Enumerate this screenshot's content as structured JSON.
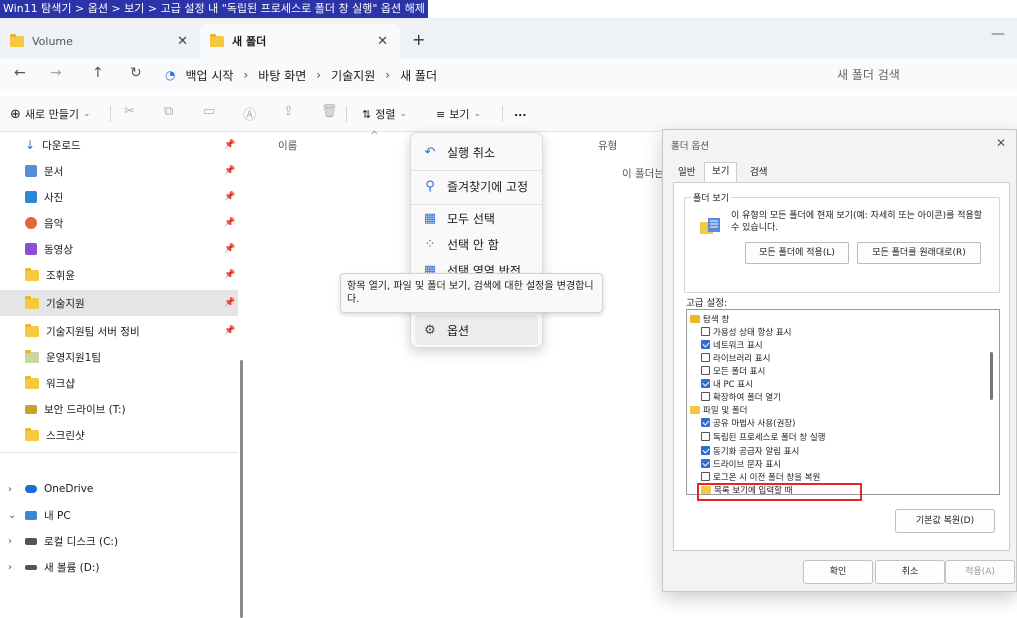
{
  "caption": "Win11 탐색기 > 옵션 > 보기 > 고급 설정 내 \"독립된 프로세스로 폴더 창 실행\" 옵션 해제",
  "tabs": [
    {
      "label": "Volume"
    },
    {
      "label": "새 폴더"
    }
  ],
  "address": {
    "crumbs": [
      "백업 시작",
      "바탕 화면",
      "기술지원",
      "새 폴더"
    ],
    "search_placeholder": "새 폴더 검색"
  },
  "toolbar": {
    "new_label": "새로 만들기",
    "sort_label": "정렬",
    "view_label": "보기",
    "more_label": "..."
  },
  "sidebar": {
    "items": [
      {
        "label": "다운로드",
        "icon": "download-icon",
        "color": "#2f6fd1"
      },
      {
        "label": "문서",
        "icon": "document-icon",
        "color": "#5b8bd8"
      },
      {
        "label": "사진",
        "icon": "pictures-icon",
        "color": "#2b88d8"
      },
      {
        "label": "음악",
        "icon": "music-icon",
        "color": "#e8633a"
      },
      {
        "label": "동영상",
        "icon": "video-icon",
        "color": "#8a4fd6"
      },
      {
        "label": "조휘윤",
        "icon": "folder-icon",
        "color": "#f5c842"
      },
      {
        "label": "기술지원",
        "icon": "folder-icon",
        "color": "#f5c842"
      },
      {
        "label": "기술지원팀 서버 정비",
        "icon": "folder-icon",
        "color": "#f5c842"
      },
      {
        "label": "운영지원1팀",
        "icon": "shared-folder-icon",
        "color": "#6aa84f"
      },
      {
        "label": "워크샵",
        "icon": "folder-icon",
        "color": "#f5c842"
      },
      {
        "label": "보안 드라이브 (T:)",
        "icon": "drive-icon",
        "color": "#c9a227"
      },
      {
        "label": "스크린샷",
        "icon": "folder-icon",
        "color": "#f5c842"
      }
    ],
    "tree": [
      {
        "label": "OneDrive",
        "icon": "cloud-icon"
      },
      {
        "label": "내 PC",
        "icon": "pc-icon"
      },
      {
        "label": "로컬 디스크 (C:)",
        "icon": "drive-icon"
      },
      {
        "label": "새 볼륨 (D:)",
        "icon": "drive-icon"
      }
    ]
  },
  "content": {
    "col_name": "이름",
    "col_type": "유형",
    "empty_text": "이 폴더는"
  },
  "menu": {
    "items": [
      {
        "label": "실행 취소",
        "icon": "undo-icon"
      },
      {
        "label": "즐겨찾기에 고정",
        "icon": "pin-icon"
      },
      {
        "label": "모두 선택",
        "icon": "select-all-icon"
      },
      {
        "label": "선택 안 함",
        "icon": "select-none-icon"
      },
      {
        "label": "선택 영역 반전",
        "icon": "invert-selection-icon"
      },
      {
        "label": "옵션",
        "icon": "options-icon"
      }
    ]
  },
  "tooltip": "항목 열기, 파일 및 폴더 보기, 검색에 대한 설정을 변경합니다.",
  "dialog": {
    "title": "폴더 옵션",
    "tabs": [
      "일반",
      "보기",
      "검색"
    ],
    "group_title": "폴더 보기",
    "group_desc": "이 유형의 모든 폴더에 현재 보기(예: 자세히 또는 아이콘)를 적용할 수 있습니다.",
    "apply_all_btn": "모든 폴더에 적용(L)",
    "reset_all_btn": "모든 폴더를 원래대로(R)",
    "advanced_label": "고급 설정:",
    "tree": [
      {
        "type": "group",
        "label": "탐색 창",
        "icon": "nav-pane-icon"
      },
      {
        "type": "check",
        "label": "가용성 상태 항상 표시",
        "checked": false
      },
      {
        "type": "check",
        "label": "네트워크 표시",
        "checked": true
      },
      {
        "type": "check",
        "label": "라이브러리 표시",
        "checked": false
      },
      {
        "type": "check",
        "label": "모든 폴더 표시",
        "checked": false
      },
      {
        "type": "check",
        "label": "내 PC 표시",
        "checked": true
      },
      {
        "type": "check",
        "label": "확장하여 폴더 열기",
        "checked": false
      },
      {
        "type": "group",
        "label": "파일 및 폴더",
        "icon": "folder-icon"
      },
      {
        "type": "check",
        "label": "공유 마법사 사용(권장)",
        "checked": true
      },
      {
        "type": "check",
        "label": "독립된 프로세스로 폴더 창 실행",
        "checked": false
      },
      {
        "type": "check",
        "label": "동기화 공급자 알림 표시",
        "checked": true
      },
      {
        "type": "check",
        "label": "드라이브 문자 표시",
        "checked": true
      },
      {
        "type": "check",
        "label": "로그온 시 이전 폴더 창을 복원",
        "checked": false
      },
      {
        "type": "group",
        "label": "목록 보기에 입력할 때",
        "icon": "folder-icon"
      }
    ],
    "restore_btn": "기본값 복원(D)",
    "ok_btn": "확인",
    "cancel_btn": "취소",
    "apply_btn": "적용(A)"
  }
}
